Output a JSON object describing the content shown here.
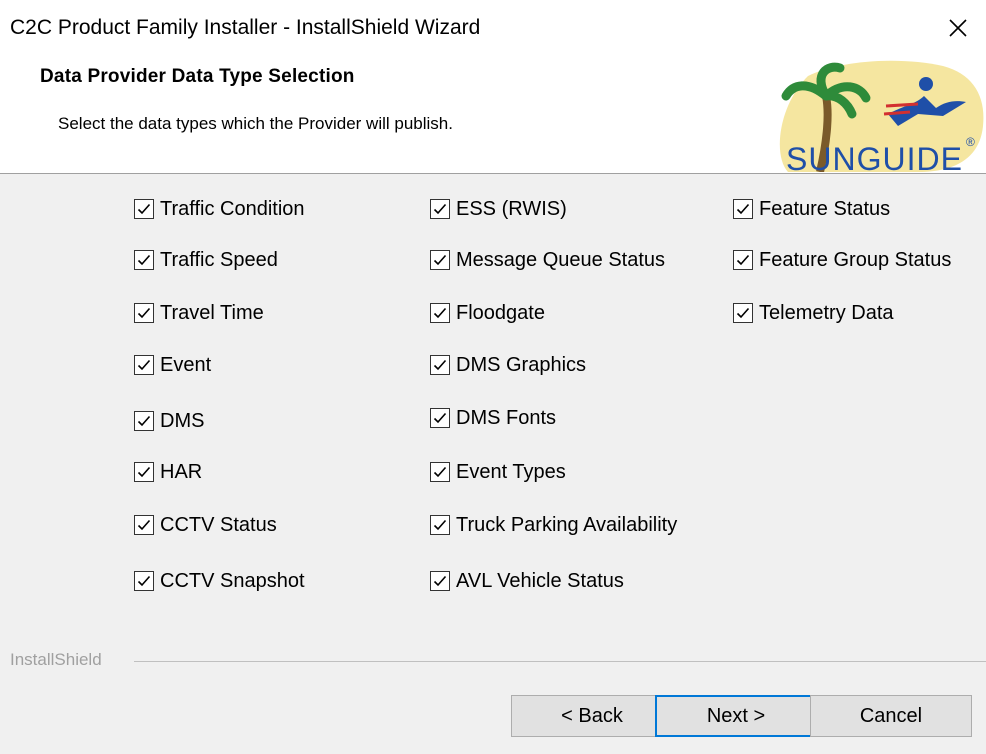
{
  "window": {
    "title": "C2C Product Family Installer - InstallShield Wizard"
  },
  "header": {
    "title": "Data Provider Data Type Selection",
    "subtitle": "Select the data types which the Provider will publish.",
    "logo_text": "SUNGUIDE",
    "logo_mark": "®"
  },
  "checkboxes": {
    "col1": [
      {
        "label": "Traffic Condition",
        "checked": true
      },
      {
        "label": "Traffic Speed",
        "checked": true
      },
      {
        "label": "Travel Time",
        "checked": true
      },
      {
        "label": "Event",
        "checked": true
      },
      {
        "label": "DMS",
        "checked": true
      },
      {
        "label": "HAR",
        "checked": true
      },
      {
        "label": "CCTV Status",
        "checked": true
      },
      {
        "label": "CCTV Snapshot",
        "checked": true
      }
    ],
    "col2": [
      {
        "label": "ESS (RWIS)",
        "checked": true
      },
      {
        "label": "Message Queue Status",
        "checked": true
      },
      {
        "label": "Floodgate",
        "checked": true
      },
      {
        "label": "DMS Graphics",
        "checked": true
      },
      {
        "label": "DMS Fonts",
        "checked": true
      },
      {
        "label": "Event Types",
        "checked": true
      },
      {
        "label": "Truck Parking Availability",
        "checked": true
      },
      {
        "label": "AVL Vehicle Status",
        "checked": true
      }
    ],
    "col3": [
      {
        "label": "Feature Status",
        "checked": true
      },
      {
        "label": "Feature Group Status",
        "checked": true
      },
      {
        "label": "Telemetry Data",
        "checked": true
      }
    ]
  },
  "footer": {
    "brand": "InstallShield",
    "back_label": "< Back",
    "next_label": "Next >",
    "cancel_label": "Cancel"
  },
  "colors": {
    "accent": "#0078d7",
    "logo_yellow": "#f5e6a0",
    "logo_blue": "#1f4fa8",
    "logo_green": "#2e8b3a"
  }
}
